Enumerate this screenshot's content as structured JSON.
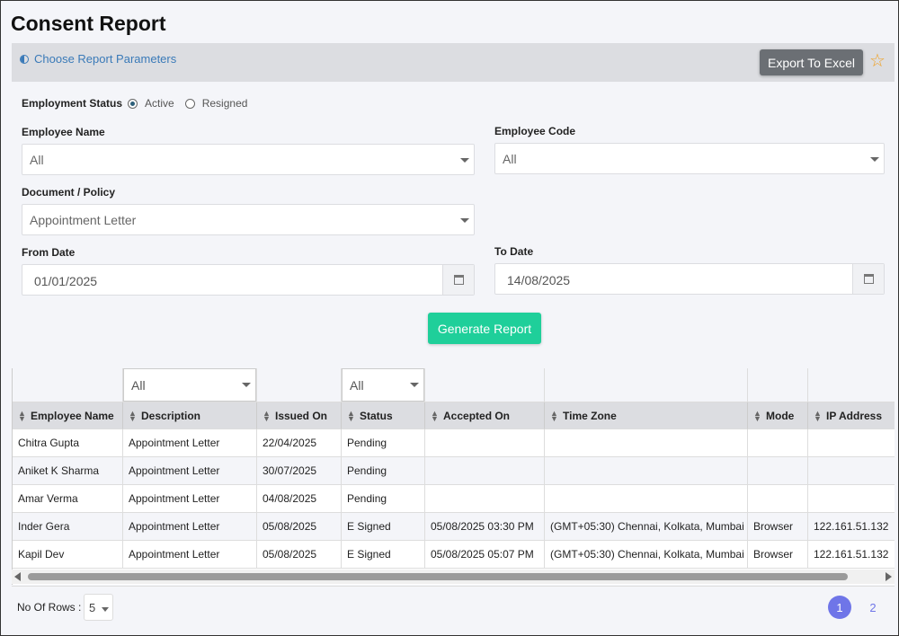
{
  "page_title": "Consent Report",
  "params": {
    "link_label": "Choose Report Parameters",
    "export_label": "Export To Excel"
  },
  "form": {
    "employment_status_label": "Employment Status",
    "status_options": [
      "Active",
      "Resigned"
    ],
    "status_selected": "Active",
    "employee_name_label": "Employee Name",
    "employee_name_value": "All",
    "employee_code_label": "Employee Code",
    "employee_code_value": "All",
    "document_label": "Document / Policy",
    "document_value": "Appointment Letter",
    "from_date_label": "From Date",
    "from_date_value": "01/01/2025",
    "to_date_label": "To Date",
    "to_date_value": "14/08/2025",
    "generate_label": "Generate Report"
  },
  "grid": {
    "filters": {
      "description": "All",
      "status": "All"
    },
    "columns": [
      "Employee Name",
      "Description",
      "Issued On",
      "Status",
      "Accepted On",
      "Time Zone",
      "Mode",
      "IP Address"
    ],
    "rows": [
      [
        "Chitra Gupta",
        "Appointment Letter",
        "22/04/2025",
        "Pending",
        "",
        "",
        "",
        ""
      ],
      [
        "Aniket K Sharma",
        "Appointment Letter",
        "30/07/2025",
        "Pending",
        "",
        "",
        "",
        ""
      ],
      [
        "Amar Verma",
        "Appointment Letter",
        "04/08/2025",
        "Pending",
        "",
        "",
        "",
        ""
      ],
      [
        "Inder Gera",
        "Appointment Letter",
        "05/08/2025",
        "E Signed",
        "05/08/2025 03:30 PM",
        "(GMT+05:30) Chennai, Kolkata, Mumbai",
        "Browser",
        "122.161.51.132"
      ],
      [
        "Kapil Dev",
        "Appointment Letter",
        "05/08/2025",
        "E Signed",
        "05/08/2025 05:07 PM",
        "(GMT+05:30) Chennai, Kolkata, Mumbai",
        "Browser",
        "122.161.51.132"
      ]
    ]
  },
  "footer": {
    "rows_label": "No Of Rows :",
    "rows_value": "5",
    "pages": [
      "1",
      "2"
    ],
    "active_page": "1"
  },
  "colors": {
    "accent": "#1fcf9a",
    "pager": "#6f75e8",
    "export": "#6b6f74",
    "star": "#f0a020"
  }
}
